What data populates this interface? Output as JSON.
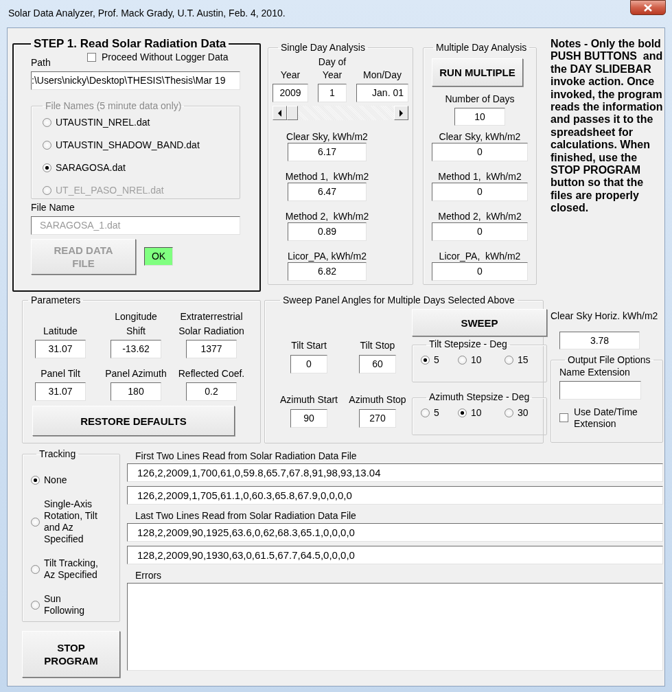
{
  "window": {
    "title": "Solar Data Analyzer, Prof. Mack Grady, U.T. Austin, Feb. 4, 2010."
  },
  "step1": {
    "title": "STEP 1.  Read Solar Radiation Data",
    "path_label": "Path",
    "proceed_checkbox": {
      "label": "Proceed Without Logger Data",
      "checked": false
    },
    "path_value": ":\\Users\\nicky\\Desktop\\THESIS\\Thesis\\Mar 19",
    "file_names": {
      "title": "File Names (5 minute data only)",
      "options": [
        {
          "label": "UTAUSTIN_NREL.dat",
          "selected": false,
          "disabled": false
        },
        {
          "label": "UTAUSTIN_SHADOW_BAND.dat",
          "selected": false,
          "disabled": false
        },
        {
          "label": "SARAGOSA.dat",
          "selected": true,
          "disabled": false
        },
        {
          "label": "UT_EL_PASO_NREL.dat",
          "selected": false,
          "disabled": true
        }
      ]
    },
    "file_name_label": "File Name",
    "file_name": {
      "value": "SARAGOSA_1.dat",
      "disabled": true
    },
    "read_button": {
      "label": "READ DATA FILE",
      "disabled": true
    },
    "status": "OK"
  },
  "single_day": {
    "title": "Single Day Analysis",
    "inputs": [
      {
        "label": "Year",
        "value": "2009"
      },
      {
        "label": "Day of Year",
        "value": "1"
      },
      {
        "label": "Mon/Day",
        "value": "Jan. 01"
      }
    ],
    "slider": {
      "level": 0
    },
    "results": [
      {
        "label": "Clear Sky, kWh/m2",
        "value": "6.17"
      },
      {
        "label": "Method 1,  kWh/m2",
        "value": "6.47"
      },
      {
        "label": "Method 2,  kWh/m2",
        "value": "0.89"
      },
      {
        "label": "Licor_PA, kWh/m2",
        "value": "6.82"
      }
    ]
  },
  "multiple_day": {
    "title": "Multiple Day Analysis",
    "button": "RUN MULTIPLE",
    "days_label": "Number of Days",
    "days_value": "10",
    "results": [
      {
        "label": "Clear Sky, kWh/m2",
        "value": "0"
      },
      {
        "label": "Method 1,  kWh/m2",
        "value": "0"
      },
      {
        "label": "Method 2,  kWh/m2",
        "value": "0"
      },
      {
        "label": "Licor_PA,  kWh/m2",
        "value": "0"
      }
    ]
  },
  "notes": "Notes - Only the bold PUSH BUTTONS  and the DAY SLIDEBAR invoke action. Once invoked, the program reads the information and passes it to the spreadsheet for calculations. When finished, use the STOP PROGRAM button so that the files are properly closed.",
  "parameters": {
    "title": "Parameters",
    "fields": [
      {
        "label": "Latitude",
        "value": "31.07"
      },
      {
        "label": "Longitude Shift",
        "value": "-13.62"
      },
      {
        "label": "Extraterrestrial Solar Radiation",
        "value": "1377"
      },
      {
        "label": "Panel Tilt",
        "value": "31.07"
      },
      {
        "label": "Panel Azimuth",
        "value": "180"
      },
      {
        "label": "Reflected Coef.",
        "value": "0.2"
      }
    ],
    "button": "RESTORE DEFAULTS"
  },
  "sweep": {
    "title": "Sweep Panel Angles for Multiple Days Selected Above",
    "button": "SWEEP",
    "tilt_fields": [
      {
        "label": "Tilt Start",
        "value": "0"
      },
      {
        "label": "Tilt Stop",
        "value": "60"
      }
    ],
    "tilt_step": {
      "title": "Tilt Stepsize - Deg",
      "options": [
        {
          "label": "5",
          "selected": true
        },
        {
          "label": "10",
          "selected": false
        },
        {
          "label": "15",
          "selected": false
        }
      ]
    },
    "azimuth_fields": [
      {
        "label": "Azimuth Start",
        "value": "90"
      },
      {
        "label": "Azimuth Stop",
        "value": "270"
      }
    ],
    "azimuth_step": {
      "title": "Azimuth Stepsize - Deg",
      "options": [
        {
          "label": "5",
          "selected": false
        },
        {
          "label": "10",
          "selected": true
        },
        {
          "label": "30",
          "selected": false
        }
      ]
    }
  },
  "clear_sky_horiz": {
    "label": "Clear Sky Horiz. kWh/m2",
    "value": "3.78"
  },
  "output_options": {
    "title": "Output File Options",
    "name_extension_label": "Name Extension",
    "date_checkbox": {
      "label": "Use Date/Time Extension",
      "checked": false
    }
  },
  "tracking": {
    "title": "Tracking",
    "options": [
      {
        "label": "None",
        "selected": true
      },
      {
        "label": "Single-Axis Rotation, Tilt and Az Specified",
        "selected": false
      },
      {
        "label": "Tilt Tracking, Az Specified",
        "selected": false
      },
      {
        "label": "Sun Following",
        "selected": false
      }
    ]
  },
  "stop_button": "STOP PROGRAM",
  "data_lines": {
    "first_label": "First Two Lines Read from Solar Radiation Data File",
    "first_lines": [
      "126,2,2009,1,700,61,0,59.8,65.7,67.8,91,98,93,13.04",
      "126,2,2009,1,705,61.1,0,60.3,65.8,67.9,0,0,0,0"
    ],
    "last_label": "Last Two Lines Read from Solar Radiation Data File",
    "last_lines": [
      "128,2,2009,90,1925,63.6,0,62,68.3,65.1,0,0,0,0",
      "128,2,2009,90,1930,63,0,61.5,67.7,64.5,0,0,0,0"
    ],
    "errors_label": "Errors"
  }
}
